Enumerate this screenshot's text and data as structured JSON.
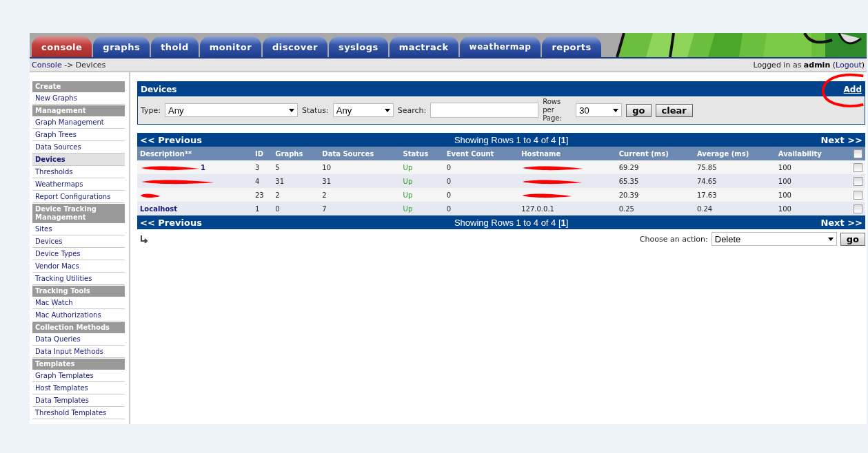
{
  "tabs": [
    {
      "label": "console",
      "selected": true
    },
    {
      "label": "graphs",
      "selected": false
    },
    {
      "label": "thold",
      "selected": false
    },
    {
      "label": "monitor",
      "selected": false
    },
    {
      "label": "discover",
      "selected": false
    },
    {
      "label": "syslogs",
      "selected": false
    },
    {
      "label": "mactrack",
      "selected": false
    },
    {
      "label": "weathermap",
      "selected": false
    },
    {
      "label": "reports",
      "selected": false
    }
  ],
  "breadcrumb": {
    "link": "Console",
    "rest": "-> Devices"
  },
  "login": {
    "prefix": "Logged in as",
    "user": "admin",
    "open": "(",
    "logout": "Logout",
    "close": ")"
  },
  "sidebar": [
    {
      "kind": "header",
      "label": "Create"
    },
    {
      "kind": "item",
      "label": "New Graphs",
      "selected": false
    },
    {
      "kind": "header",
      "label": "Management"
    },
    {
      "kind": "item",
      "label": "Graph Management",
      "selected": false
    },
    {
      "kind": "item",
      "label": "Graph Trees",
      "selected": false
    },
    {
      "kind": "item",
      "label": "Data Sources",
      "selected": false
    },
    {
      "kind": "item",
      "label": "Devices",
      "selected": true
    },
    {
      "kind": "item",
      "label": "Thresholds",
      "selected": false
    },
    {
      "kind": "item",
      "label": "Weathermaps",
      "selected": false
    },
    {
      "kind": "item",
      "label": "Report Configurations",
      "selected": false
    },
    {
      "kind": "header",
      "label": "Device Tracking Management"
    },
    {
      "kind": "item",
      "label": "Sites",
      "selected": false
    },
    {
      "kind": "item",
      "label": "Devices",
      "selected": false
    },
    {
      "kind": "item",
      "label": "Device Types",
      "selected": false
    },
    {
      "kind": "item",
      "label": "Vendor Macs",
      "selected": false
    },
    {
      "kind": "item",
      "label": "Tracking Utilities",
      "selected": false
    },
    {
      "kind": "header",
      "label": "Tracking Tools"
    },
    {
      "kind": "item",
      "label": "Mac Watch",
      "selected": false
    },
    {
      "kind": "item",
      "label": "Mac Authorizations",
      "selected": false
    },
    {
      "kind": "header",
      "label": "Collection Methods"
    },
    {
      "kind": "item",
      "label": "Data Queries",
      "selected": false
    },
    {
      "kind": "item",
      "label": "Data Input Methods",
      "selected": false
    },
    {
      "kind": "header",
      "label": "Templates"
    },
    {
      "kind": "item",
      "label": "Graph Templates",
      "selected": false
    },
    {
      "kind": "item",
      "label": "Host Templates",
      "selected": false
    },
    {
      "kind": "item",
      "label": "Data Templates",
      "selected": false
    },
    {
      "kind": "item",
      "label": "Threshold Templates",
      "selected": false
    }
  ],
  "panel": {
    "title": "Devices",
    "add": "Add",
    "add_circled": true
  },
  "filter": {
    "type_label": "Type:",
    "type_value": "Any",
    "status_label": "Status:",
    "status_value": "Any",
    "search_label": "Search:",
    "rows_label": "Rows per Page:",
    "rows_value": "30",
    "go": "go",
    "clear": "clear"
  },
  "pagers": [
    {
      "previous": "<< Previous",
      "showing": "Showing Rows 1 to 4 of 4 [**1**]",
      "next": "Next >>"
    },
    {
      "previous": "<< Previous",
      "showing": "Showing Rows 1 to 4 of 4 [**1**]",
      "next": "Next >>"
    }
  ],
  "table": {
    "columns": [
      "Description**",
      "ID",
      "Graphs",
      "Data Sources",
      "Status",
      "Event Count",
      "Hostname",
      "Current (ms)",
      "Average (ms)",
      "Availability"
    ],
    "select_all_checked": false,
    "rows": [
      {
        "description": "1",
        "description_redacted": true,
        "id": "3",
        "graphs": "5",
        "data_sources": "10",
        "status": "Up",
        "event_count": "0",
        "hostname_redacted": true,
        "current": "69.29",
        "average": "75.85",
        "availability": "100",
        "checked": false
      },
      {
        "description_redacted": true,
        "id": "4",
        "graphs": "31",
        "data_sources": "31",
        "status": "Up",
        "event_count": "0",
        "hostname_redacted": true,
        "current": "65.35",
        "average": "74.65",
        "availability": "100",
        "checked": false
      },
      {
        "description_redacted": true,
        "id": "23",
        "graphs": "2",
        "data_sources": "2",
        "status": "Up",
        "event_count": "0",
        "hostname_redacted": true,
        "current": "20.39",
        "average": "17.63",
        "availability": "100",
        "checked": false
      },
      {
        "description": "Localhost",
        "description_redacted": false,
        "id": "1",
        "graphs": "0",
        "data_sources": "7",
        "status": "Up",
        "event_count": "0",
        "hostname": "127.0.0.1",
        "hostname_redacted": false,
        "current": "0.25",
        "average": "0.24",
        "availability": "100",
        "checked": false
      }
    ]
  },
  "action": {
    "label": "Choose an action:",
    "value": "Delete",
    "go": "go"
  }
}
